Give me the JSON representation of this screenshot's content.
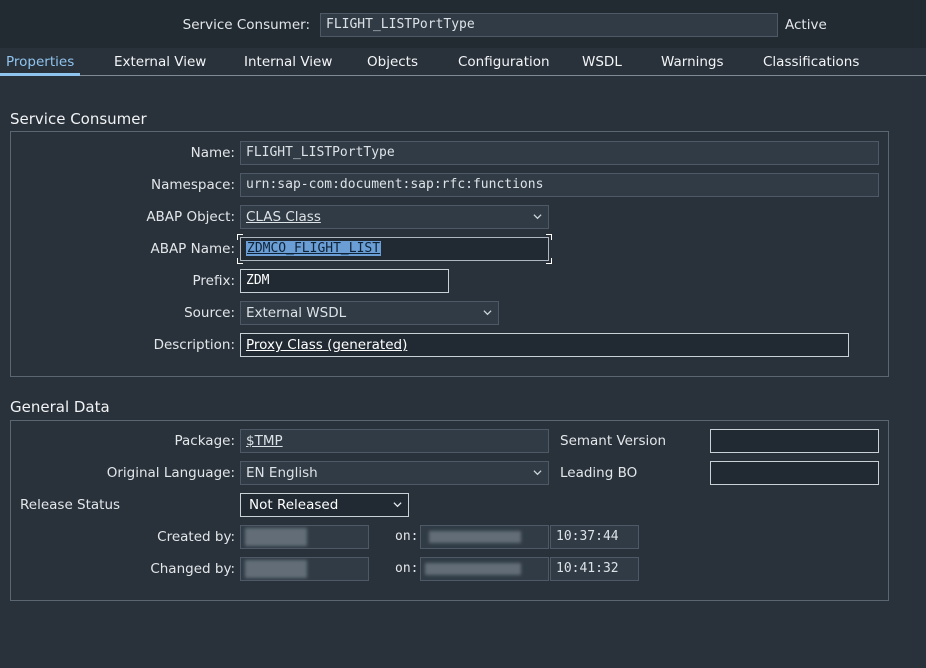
{
  "header": {
    "service_consumer_label": "Service Consumer:",
    "service_consumer_value": "FLIGHT_LISTPortType",
    "status": "Active"
  },
  "tabs": [
    {
      "label": "Properties",
      "active": true
    },
    {
      "label": "External View"
    },
    {
      "label": "Internal View"
    },
    {
      "label": "Objects"
    },
    {
      "label": "Configuration"
    },
    {
      "label": "WSDL"
    },
    {
      "label": "Warnings"
    },
    {
      "label": "Classifications"
    }
  ],
  "service_consumer_group": {
    "title": "Service Consumer",
    "name_label": "Name:",
    "name_value": "FLIGHT_LISTPortType",
    "namespace_label": "Namespace:",
    "namespace_value": "urn:sap-com:document:sap:rfc:functions",
    "abap_object_label": "ABAP Object:",
    "abap_object_value": "CLAS Class",
    "abap_name_label": "ABAP Name:",
    "abap_name_value": "ZDMCO_FLIGHT_LIST",
    "prefix_label": "Prefix:",
    "prefix_value": "ZDM",
    "source_label": "Source:",
    "source_value": "External WSDL",
    "description_label": "Description:",
    "description_value": "Proxy Class (generated)"
  },
  "general_data_group": {
    "title": "General Data",
    "package_label": "Package:",
    "package_value": "$TMP",
    "original_language_label": "Original Language:",
    "original_language_value": "EN English",
    "release_status_label": "Release Status",
    "release_status_value": "Not Released",
    "semant_version_label": "Semant Version",
    "semant_version_value": "",
    "leading_bo_label": "Leading BO",
    "leading_bo_value": "",
    "created_by_label": "Created by:",
    "created_on_label": "on:",
    "created_time": "10:37:44",
    "changed_by_label": "Changed by:",
    "changed_on_label": "on:",
    "changed_time": "10:41:32"
  },
  "icons": {
    "dropdown": "chevron-down-icon"
  },
  "colors": {
    "background": "#29313a",
    "active_tab": "#8fc4ee",
    "selection": "#6a9ed4"
  }
}
